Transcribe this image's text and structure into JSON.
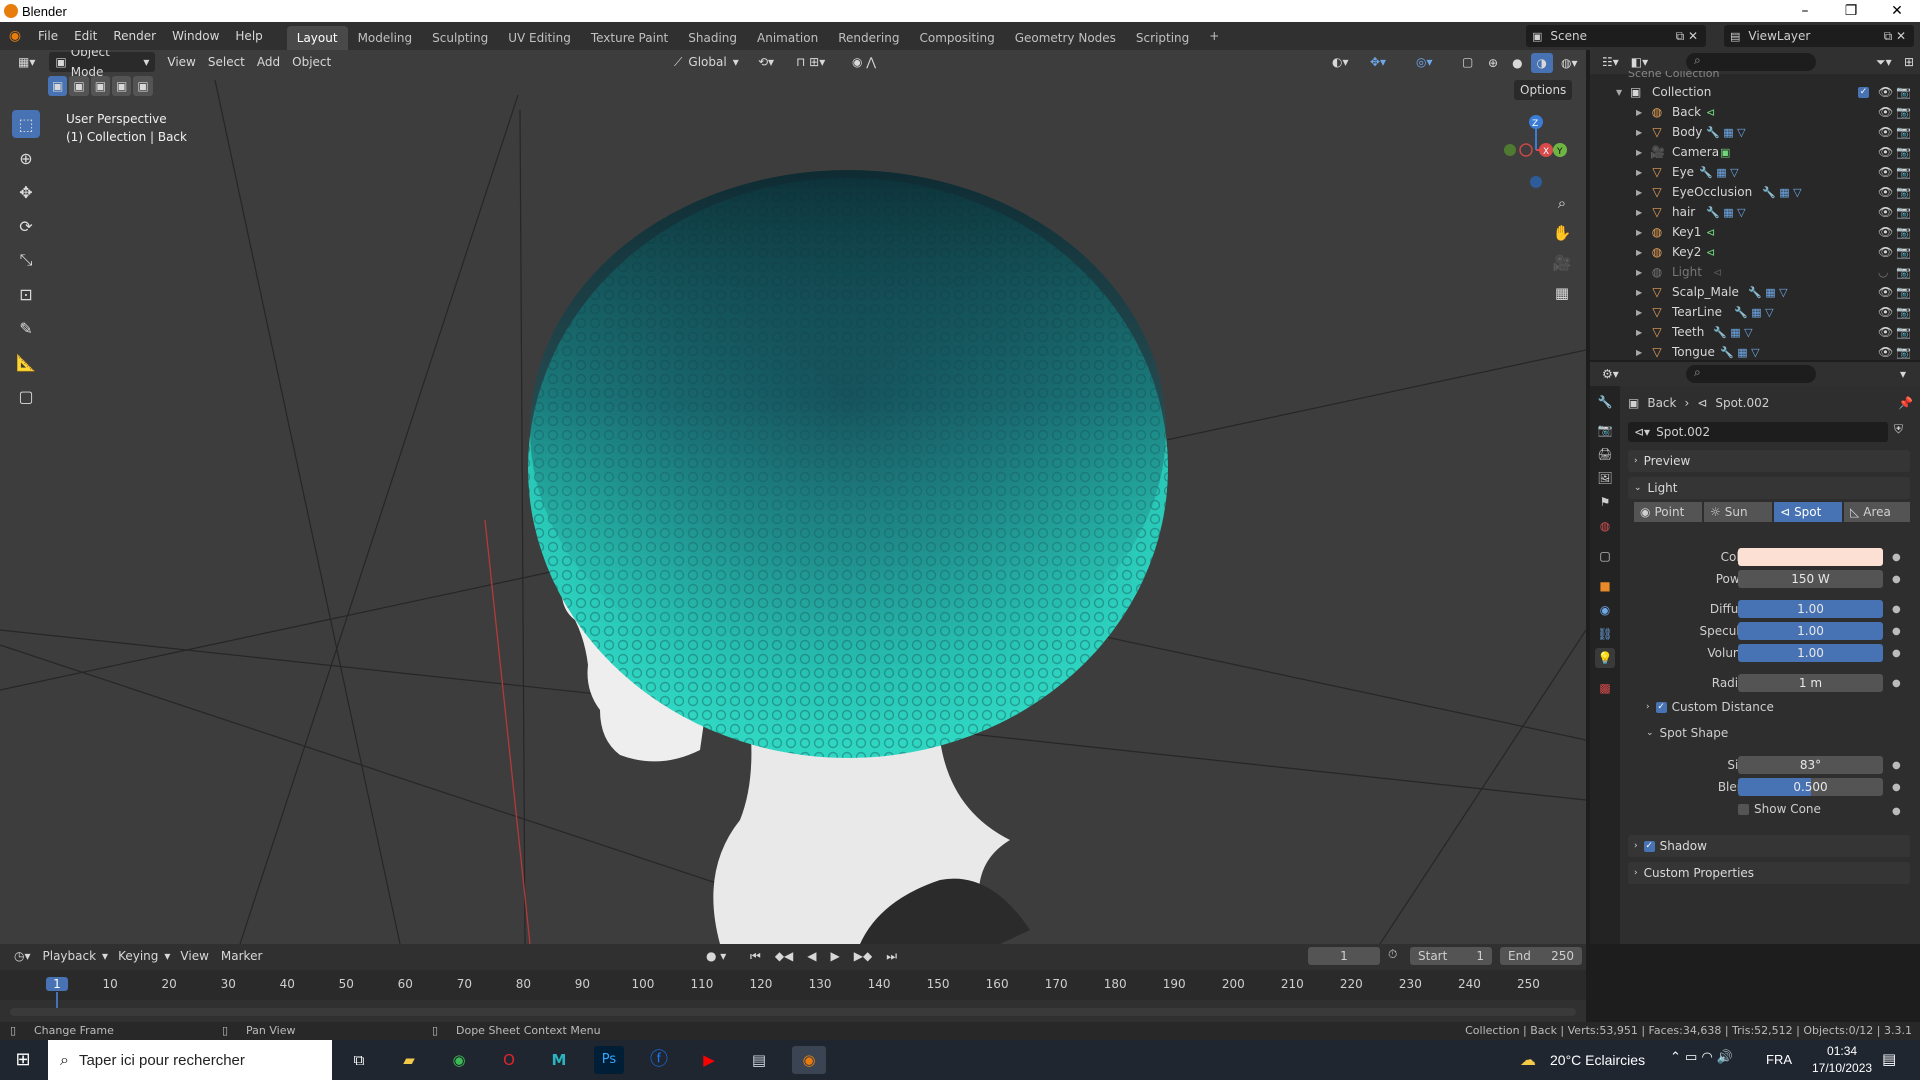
{
  "window": {
    "title": "Blender"
  },
  "menu": {
    "items": [
      "File",
      "Edit",
      "Render",
      "Window",
      "Help"
    ]
  },
  "workspaces": [
    "Layout",
    "Modeling",
    "Sculpting",
    "UV Editing",
    "Texture Paint",
    "Shading",
    "Animation",
    "Rendering",
    "Compositing",
    "Geometry Nodes",
    "Scripting"
  ],
  "workspace_add": "+",
  "scene": {
    "name": "Scene",
    "view_layer": "ViewLayer"
  },
  "viewport": {
    "mode": "Object Mode",
    "menus": [
      "View",
      "Select",
      "Add",
      "Object"
    ],
    "orientation": "Global",
    "options_label": "Options",
    "info_line1": "User Perspective",
    "info_line2": "(1) Collection | Back",
    "axis_labels": {
      "x": "X",
      "y": "Y",
      "z": "Z"
    }
  },
  "outliner": {
    "header_partial": "Scene Collection",
    "collection": "Collection",
    "items": [
      {
        "name": "Back",
        "type": "light",
        "dim": false
      },
      {
        "name": "Body",
        "type": "mesh",
        "dim": false
      },
      {
        "name": "Camera",
        "type": "camera",
        "dim": false
      },
      {
        "name": "Eye",
        "type": "mesh",
        "dim": false
      },
      {
        "name": "EyeOcclusion",
        "type": "mesh",
        "dim": false
      },
      {
        "name": "hair",
        "type": "mesh",
        "dim": false
      },
      {
        "name": "Key1",
        "type": "light",
        "dim": false
      },
      {
        "name": "Key2",
        "type": "light",
        "dim": false
      },
      {
        "name": "Light",
        "type": "light",
        "dim": true
      },
      {
        "name": "Scalp_Male",
        "type": "mesh",
        "dim": false
      },
      {
        "name": "TearLine",
        "type": "mesh",
        "dim": false
      },
      {
        "name": "Teeth",
        "type": "mesh",
        "dim": false
      },
      {
        "name": "Tongue",
        "type": "mesh",
        "dim": false
      }
    ]
  },
  "properties": {
    "breadcrumb_object": "Back",
    "breadcrumb_data": "Spot.002",
    "datablock": "Spot.002",
    "panels": {
      "preview": "Preview",
      "light": "Light",
      "shadow": "Shadow",
      "custom_props": "Custom Properties"
    },
    "light_types": [
      "Point",
      "Sun",
      "Spot",
      "Area"
    ],
    "active_type": "Spot",
    "color_label": "Color",
    "light_color": "#fde0d4",
    "power_label": "Power",
    "power": "150 W",
    "diffuse_label": "Diffuse",
    "diffuse": "1.00",
    "specular_label": "Specular",
    "specular": "1.00",
    "volume_label": "Volume",
    "volume": "1.00",
    "radius_label": "Radius",
    "radius": "1 m",
    "custom_distance": "Custom Distance",
    "spot_shape": "Spot Shape",
    "size_label": "Size",
    "size": "83°",
    "blend_label": "Blend",
    "blend": "0.500",
    "blend_fraction": 0.5,
    "show_cone": "Show Cone"
  },
  "timeline": {
    "menus": [
      "Playback",
      "Keying",
      "View",
      "Marker"
    ],
    "current_frame": "1",
    "start_label": "Start",
    "start": "1",
    "end_label": "End",
    "end": "250",
    "ticks": [
      "1",
      "10",
      "20",
      "30",
      "40",
      "50",
      "60",
      "70",
      "80",
      "90",
      "100",
      "110",
      "120",
      "130",
      "140",
      "150",
      "160",
      "170",
      "180",
      "190",
      "200",
      "210",
      "220",
      "230",
      "240",
      "250"
    ]
  },
  "statusbar": {
    "left1": "Change Frame",
    "left2": "Pan View",
    "left3": "Dope Sheet Context Menu",
    "right": "Collection | Back | Verts:53,951 | Faces:34,638 | Tris:52,512 | Objects:0/12 | 3.3.1"
  },
  "taskbar": {
    "search_placeholder": "Taper ici pour rechercher",
    "weather": "20°C  Eclaircies",
    "lang": "FRA",
    "time": "01:34",
    "date": "17/10/2023"
  }
}
